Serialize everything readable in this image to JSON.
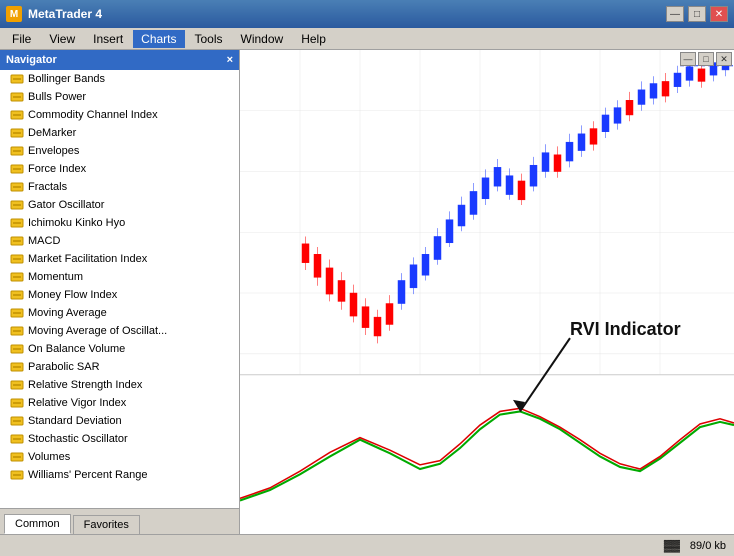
{
  "titleBar": {
    "title": "MetaTrader 4",
    "controls": {
      "minimize": "—",
      "maximize": "□",
      "close": "✕"
    }
  },
  "menuBar": {
    "items": [
      "File",
      "View",
      "Insert",
      "Charts",
      "Tools",
      "Window",
      "Help"
    ],
    "activeItem": "Charts"
  },
  "navigator": {
    "title": "Navigator",
    "closeBtn": "×",
    "items": [
      "Bollinger Bands",
      "Bulls Power",
      "Commodity Channel Index",
      "DeMarker",
      "Envelopes",
      "Force Index",
      "Fractals",
      "Gator Oscillator",
      "Ichimoku Kinko Hyo",
      "MACD",
      "Market Facilitation Index",
      "Momentum",
      "Money Flow Index",
      "Moving Average",
      "Moving Average of Oscillat...",
      "On Balance Volume",
      "Parabolic SAR",
      "Relative Strength Index",
      "Relative Vigor Index",
      "Standard Deviation",
      "Stochastic Oscillator",
      "Volumes",
      "Williams' Percent Range"
    ],
    "tabs": [
      {
        "label": "Common",
        "active": true
      },
      {
        "label": "Favorites",
        "active": false
      }
    ]
  },
  "chart": {
    "annotation": "RVI Indicator",
    "statusBar": {
      "chartIcon": "▓▓",
      "fileSize": "89/0 kb"
    }
  },
  "innerWindow": {
    "minimize": "—",
    "restore": "□",
    "close": "✕"
  }
}
